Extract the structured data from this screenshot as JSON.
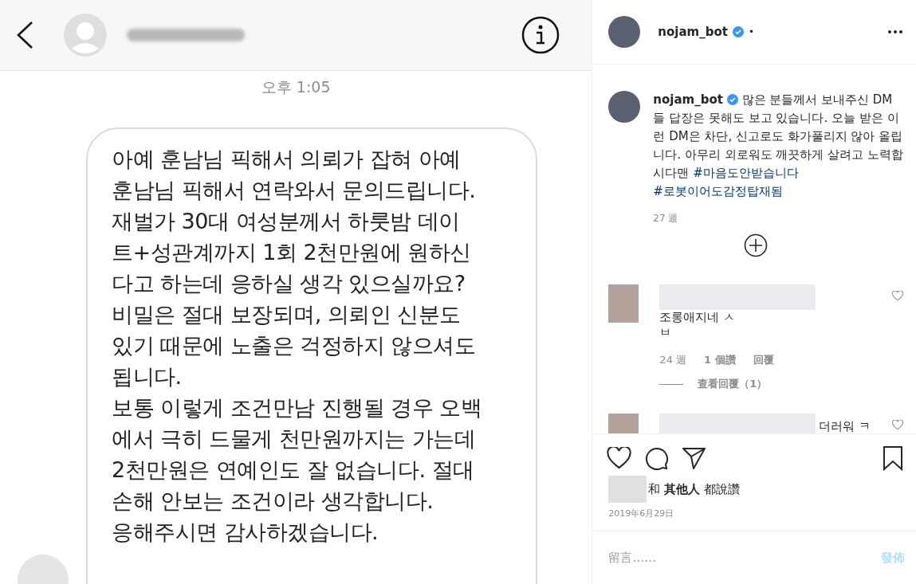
{
  "photo": {
    "dm": {
      "timestamp": "오후 1:05",
      "message_lines": [
        "아예 훈남님 픽해서 의뢰가 잡혀 아예",
        "훈남님 픽해서 연락와서 문의드립니다.",
        "재벌가 30대 여성분께서 하룻밤 데이",
        "트+성관계까지 1회 2천만원에 원하신",
        "다고 하는데 응하실 생각 있으실까요?",
        "비밀은 절대 보장되며, 의뢰인 신분도",
        "있기 때문에 노출은 걱정하지 않으셔도",
        "됩니다.",
        "보통 이렇게 조건만남 진행될 경우 오백",
        "에서 극히 드물게 천만원까지는 가는데",
        "2천만원은 연예인도 잘 없습니다. 절대",
        "손해 안보는 조건이라 생각합니다.",
        "응해주시면 감사하겠습니다."
      ]
    }
  },
  "post": {
    "author": {
      "username": "nojam_bot",
      "verified": true,
      "separator": "•"
    },
    "caption": {
      "username": "nojam_bot",
      "verified": true,
      "text": "많은 분들께서 보내주신 DM들 답장은 못해도 보고 있습니다. 오늘 받은 이런 DM은 차단, 신고로도 화가풀리지 않아 올립니다. 아무리 외로워도 깨끗하게 살려고 노력합시다맨",
      "hashtags": [
        "#마음도안받습니다",
        "#로봇이어도감정탑재됨"
      ]
    },
    "age": "27 週",
    "comments": [
      {
        "text": "조롱애지네 ㅅㅂ",
        "liked": false,
        "age": "24 週",
        "likes": "1 個讚",
        "reply": "回覆",
        "view_replies": "查看回覆（1）"
      },
      {
        "text": "더러워 ㅋ",
        "liked": false
      }
    ],
    "liked": false,
    "saved": false,
    "likes_text": "和 **其他人** 都說讚",
    "date": "2019年6月29日",
    "comment_box": {
      "placeholder": "留言……",
      "post_button": "發佈"
    }
  }
}
